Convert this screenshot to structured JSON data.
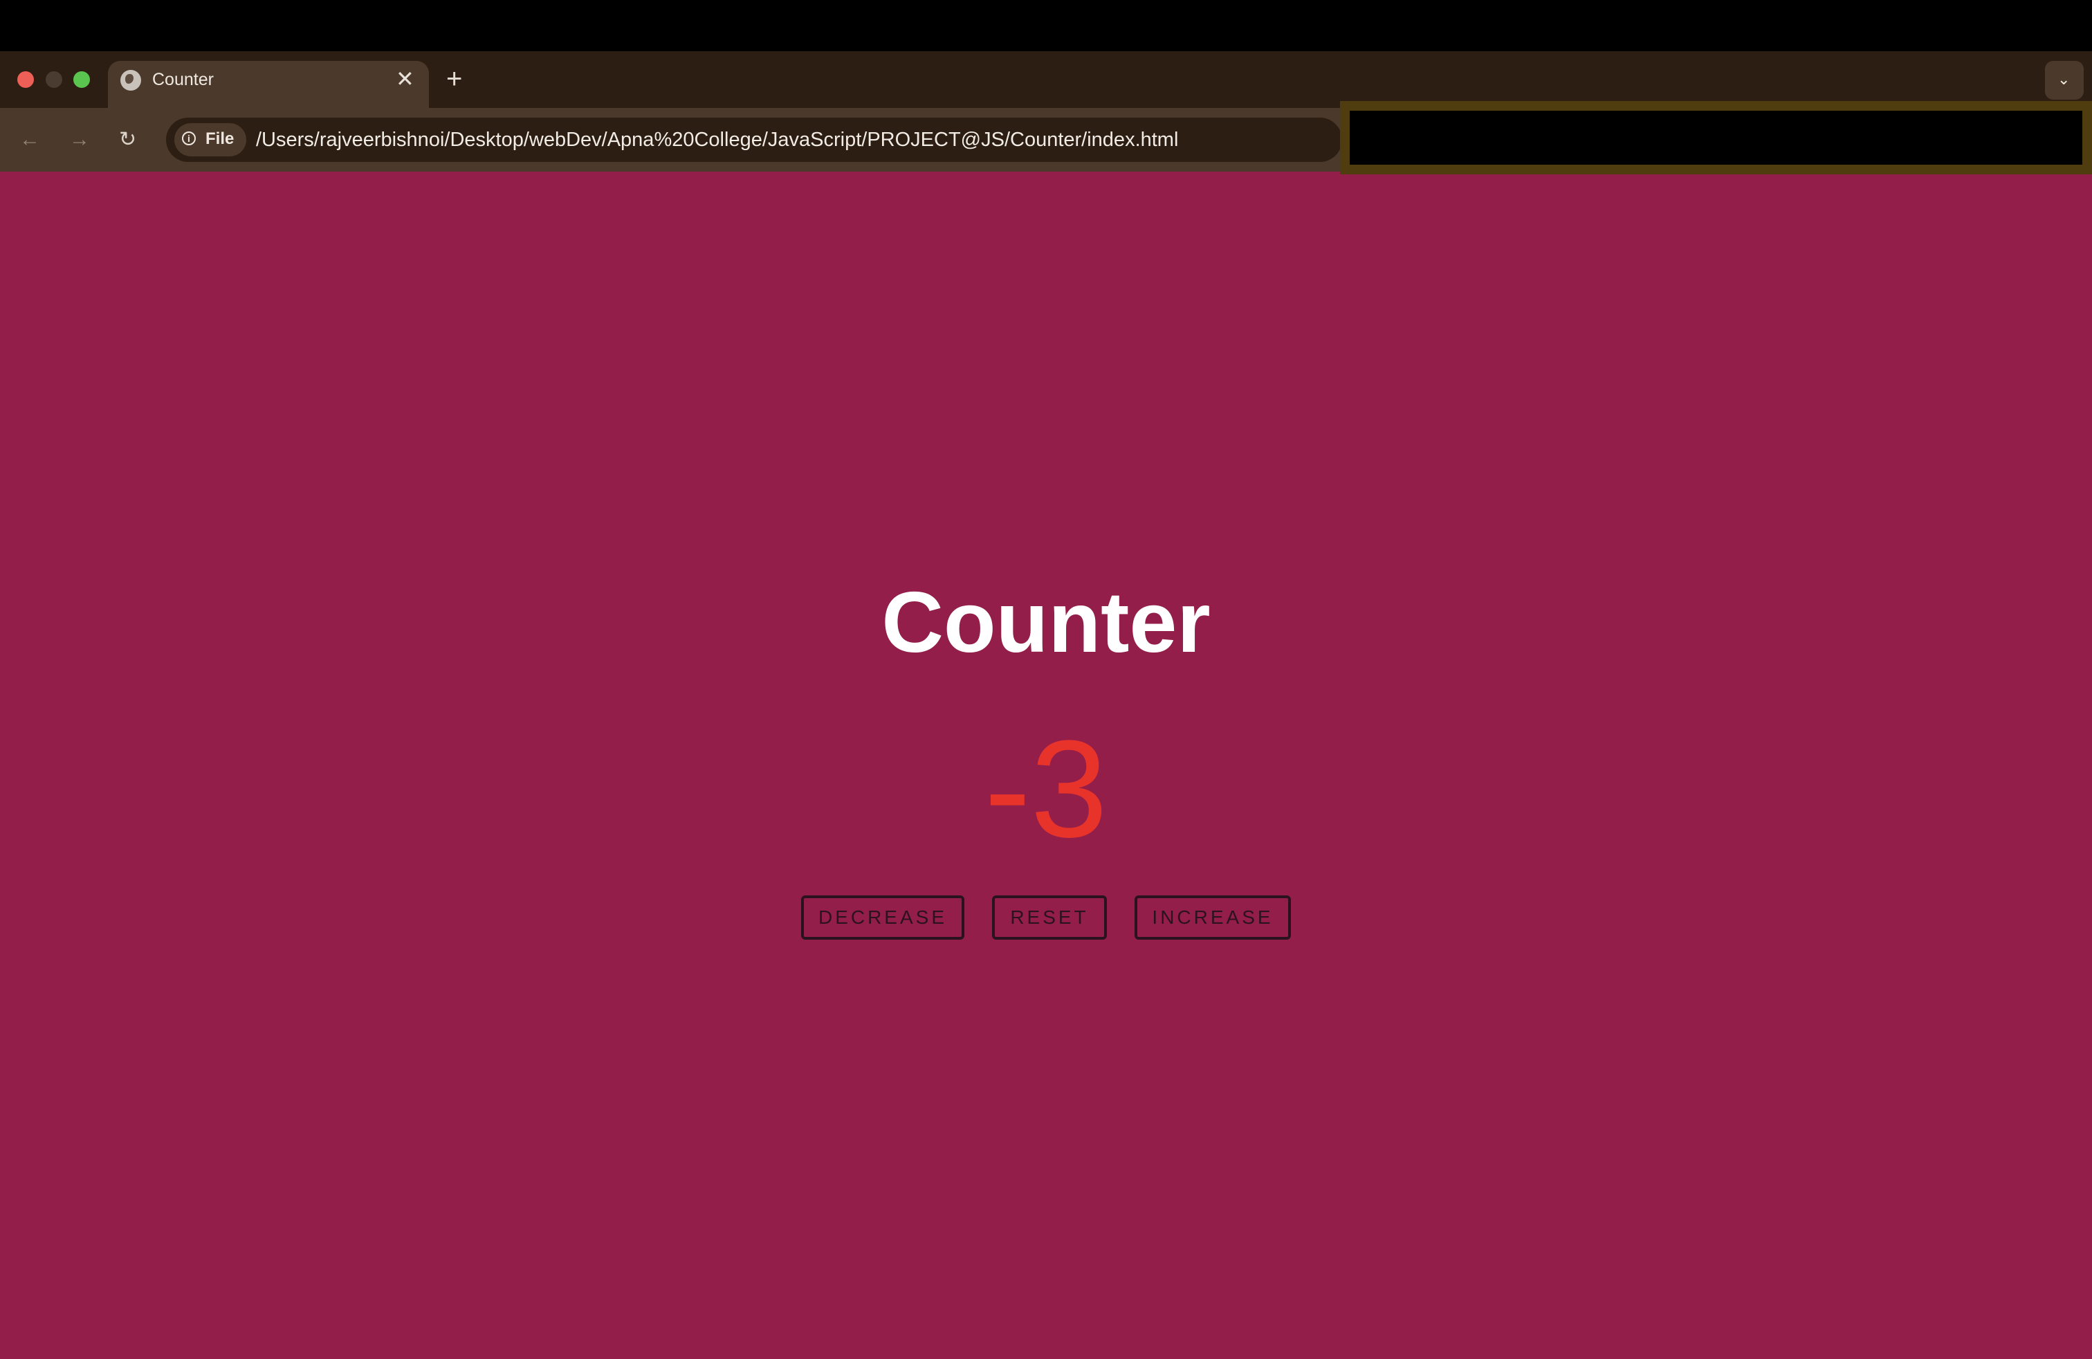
{
  "browser": {
    "tab": {
      "title": "Counter",
      "close_glyph": "✕"
    },
    "new_tab_glyph": "+",
    "tab_dropdown_glyph": "⌄",
    "nav": {
      "back_glyph": "←",
      "forward_glyph": "→",
      "reload_glyph": "↻"
    },
    "address": {
      "chip_label": "File",
      "info_glyph": "i",
      "url": "/Users/rajveerbishnoi/Desktop/webDev/Apna%20College/JavaScript/PROJECT@JS/Counter/index.html"
    },
    "colors": {
      "tab_strip": "#2c1e12",
      "toolbar": "#4b3a2b"
    }
  },
  "page": {
    "title": "Counter",
    "value": "-3",
    "value_color": "#e8332a",
    "background": "#931e4a",
    "buttons": {
      "decrease": "DECREASE",
      "reset": "RESET",
      "increase": "INCREASE"
    }
  }
}
